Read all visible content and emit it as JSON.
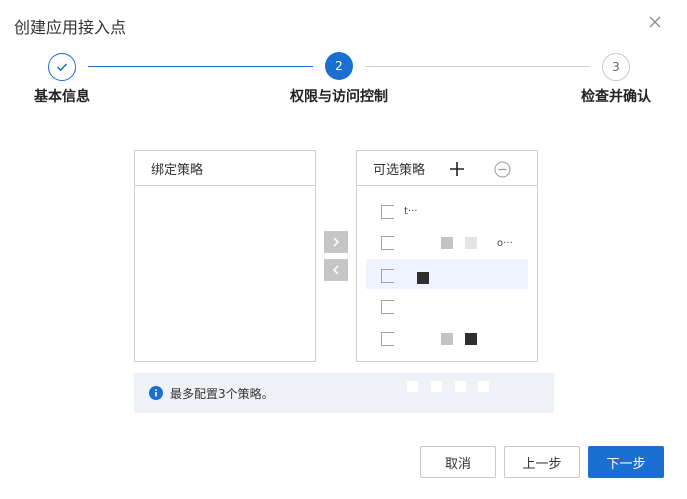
{
  "dialog": {
    "title": "创建应用接入点"
  },
  "stepper": {
    "steps": [
      {
        "label": "基本信息",
        "status": "done"
      },
      {
        "label": "权限与访问控制",
        "number": "2",
        "status": "active"
      },
      {
        "label": "检查并确认",
        "number": "3",
        "status": "pending"
      }
    ]
  },
  "transfer": {
    "left_panel_title": "绑定策略",
    "right_panel_title": "可选策略",
    "right_options": [
      {
        "text": "t···"
      },
      {
        "text": "o···"
      }
    ]
  },
  "info": {
    "text": "最多配置3个策略。"
  },
  "buttons": {
    "cancel": "取消",
    "prev": "上一步",
    "next": "下一步"
  },
  "colors": {
    "accent": "#1a6fd1",
    "info_bg": "#eef1f5",
    "border": "#cfcfcf"
  }
}
